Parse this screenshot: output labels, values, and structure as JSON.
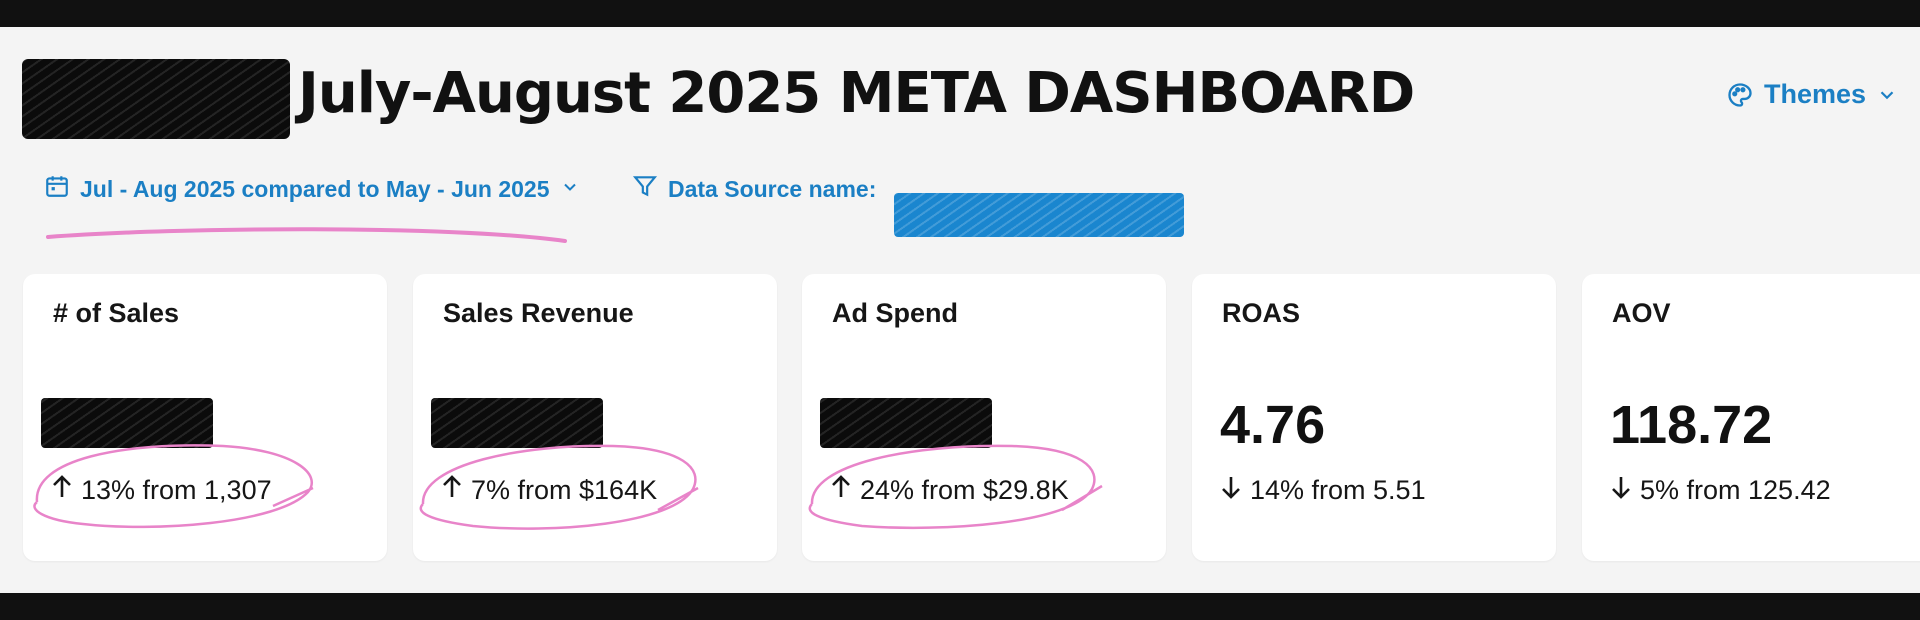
{
  "page": {
    "title": "July-August 2025 META DASHBOARD"
  },
  "header": {
    "themes_label": "Themes"
  },
  "filters": {
    "date_range": "Jul - Aug 2025 compared to May - Jun 2025",
    "data_source_label": "Data Source name:"
  },
  "kpis": [
    {
      "label": "# of Sales",
      "direction": "up",
      "change_text": "13% from 1,307"
    },
    {
      "label": "Sales Revenue",
      "direction": "up",
      "change_text": "7% from $164K"
    },
    {
      "label": "Ad Spend",
      "direction": "up",
      "change_text": "24% from $29.8K"
    },
    {
      "label": "ROAS",
      "value": "4.76",
      "direction": "down",
      "change_text": "14% from 5.51"
    },
    {
      "label": "AOV",
      "value": "118.72",
      "direction": "down",
      "change_text": "5% from 125.42"
    }
  ],
  "colors": {
    "accent": "#1b7fc4",
    "annotation": "#e884c9",
    "background": "#f4f4f4",
    "frame": "#111111"
  },
  "icons": {
    "themes": "palette-icon",
    "chevron": "chevron-down-icon",
    "calendar": "calendar-icon",
    "filter": "filter-icon",
    "up": "arrow-up-icon",
    "down": "arrow-down-icon"
  }
}
